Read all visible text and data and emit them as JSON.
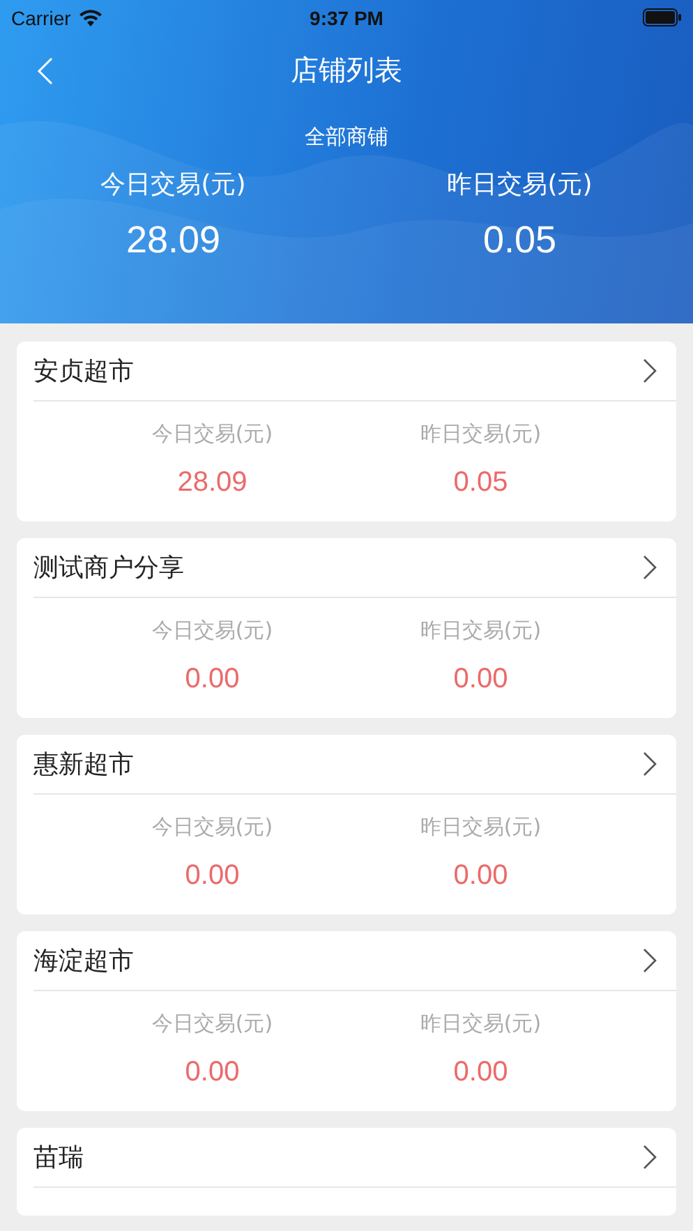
{
  "status_bar": {
    "carrier": "Carrier",
    "time": "9:37 PM"
  },
  "nav": {
    "title": "店铺列表"
  },
  "summary": {
    "title": "全部商铺",
    "stats": [
      {
        "label": "今日交易(元)",
        "value": "28.09"
      },
      {
        "label": "昨日交易(元)",
        "value": "0.05"
      }
    ]
  },
  "shops": [
    {
      "name": "安贞超市",
      "stats": [
        {
          "label": "今日交易(元)",
          "value": "28.09"
        },
        {
          "label": "昨日交易(元)",
          "value": "0.05"
        }
      ]
    },
    {
      "name": "测试商户分享",
      "stats": [
        {
          "label": "今日交易(元)",
          "value": "0.00"
        },
        {
          "label": "昨日交易(元)",
          "value": "0.00"
        }
      ]
    },
    {
      "name": "惠新超市",
      "stats": [
        {
          "label": "今日交易(元)",
          "value": "0.00"
        },
        {
          "label": "昨日交易(元)",
          "value": "0.00"
        }
      ]
    },
    {
      "name": "海淀超市",
      "stats": [
        {
          "label": "今日交易(元)",
          "value": "0.00"
        },
        {
          "label": "昨日交易(元)",
          "value": "0.00"
        }
      ]
    },
    {
      "name": "苗瑞"
    }
  ]
}
